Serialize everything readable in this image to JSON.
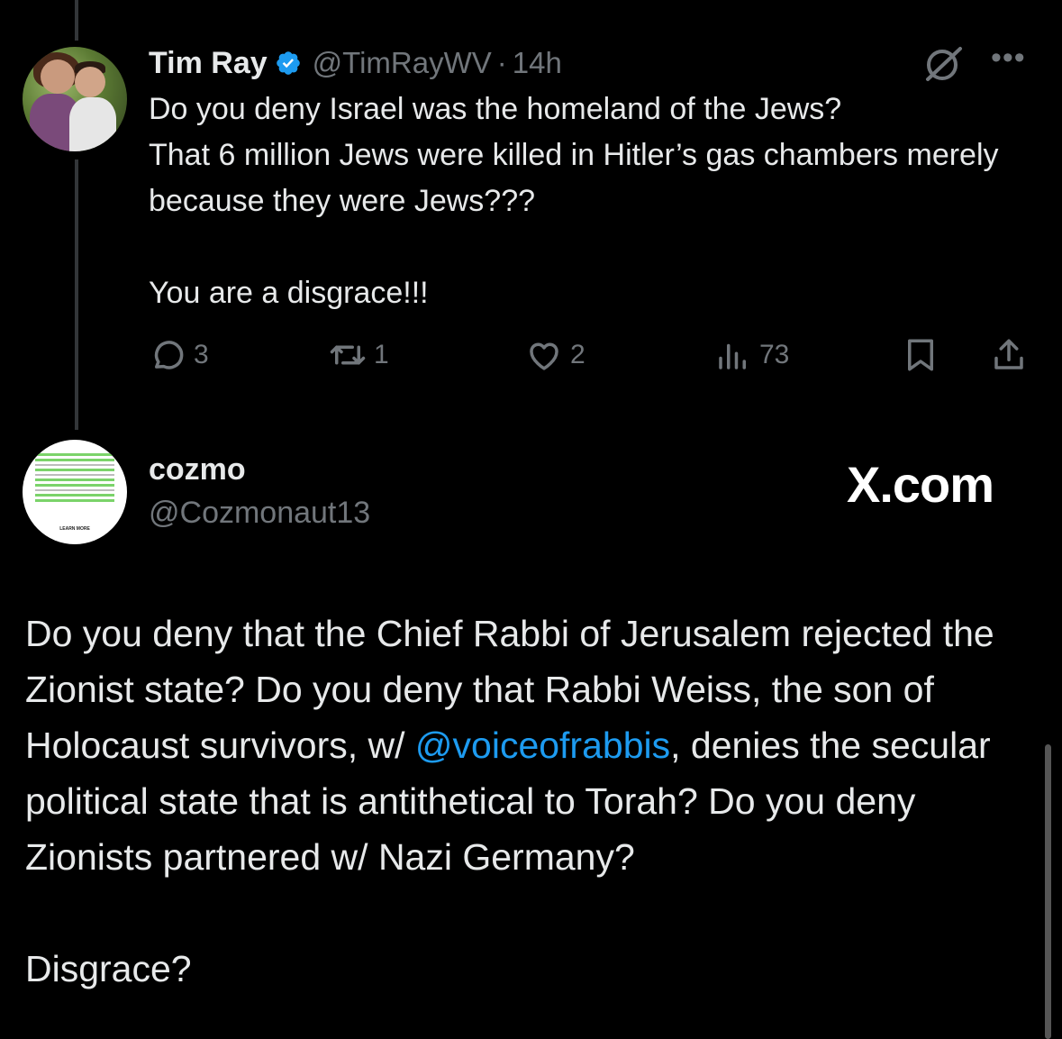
{
  "tweet": {
    "author_name": "Tim Ray",
    "verified": true,
    "handle": "@TimRayWV",
    "separator": "·",
    "time": "14h",
    "text": "Do you deny Israel was the homeland of the Jews?\nThat 6 million Jews were killed in Hitler’s gas chambers merely because they were Jews???\n\nYou are a disgrace!!!",
    "more_label": "•••",
    "actions": {
      "replies": "3",
      "reposts": "1",
      "likes": "2",
      "views": "73"
    },
    "icons": [
      "grok-icon",
      "more-icon",
      "reply-icon",
      "repost-icon",
      "like-icon",
      "views-icon",
      "bookmark-icon",
      "share-icon"
    ]
  },
  "reply": {
    "author_name": "cozmo",
    "handle": "@Cozmonaut13",
    "watermark": "X.com",
    "avatar_caption": "LEARN MORE",
    "text_before_mention": "Do you deny that the Chief Rabbi of Jerusalem rejected the Zionist state? Do you deny that Rabbi Weiss, the son of Holocaust survivors, w/ ",
    "mention": "@voiceofrabbis",
    "text_after_mention": ", denies the secular political state that is antithetical to Torah? Do you deny Zionists partnered w/ Nazi Germany?",
    "closing": "Disgrace?"
  },
  "colors": {
    "background": "#000000",
    "text": "#e7e9ea",
    "muted": "#71767b",
    "link": "#1d9bf0",
    "verified": "#1d9bf0"
  }
}
